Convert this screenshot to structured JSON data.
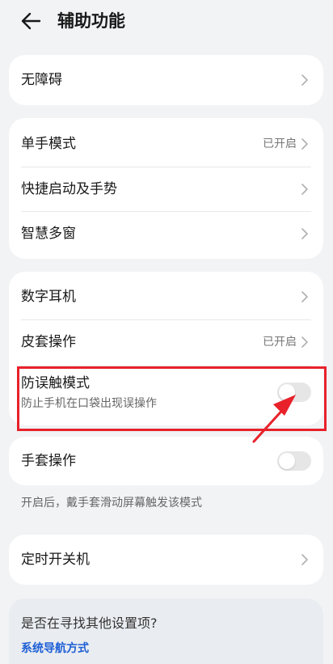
{
  "header": {
    "title": "辅助功能",
    "back_icon": "arrow-left-icon"
  },
  "cards": {
    "accessibility": {
      "label": "无障碍"
    },
    "group2": {
      "one_hand": {
        "label": "单手模式",
        "value": "已开启"
      },
      "quick_launch": {
        "label": "快捷启动及手势"
      },
      "smart_window": {
        "label": "智慧多窗"
      }
    },
    "group3": {
      "digital_earphone": {
        "label": "数字耳机"
      },
      "cover_operation": {
        "label": "皮套操作",
        "value": "已开启"
      },
      "anti_mistouch": {
        "label": "防误触模式",
        "sublabel": "防止手机在口袋出现误操作",
        "enabled": false
      }
    },
    "glove": {
      "label": "手套操作",
      "enabled": false,
      "note": "开启后，戴手套滑动屏幕触发该模式"
    },
    "scheduled_power": {
      "label": "定时开关机"
    }
  },
  "suggestion": {
    "title": "是否在寻找其他设置项?",
    "link": "系统导航方式"
  },
  "colors": {
    "background": "#f1f3f5",
    "card": "#ffffff",
    "annotation": "#e8212a",
    "link": "#1d5fd6",
    "toggle_off": "#e6e6e6"
  }
}
